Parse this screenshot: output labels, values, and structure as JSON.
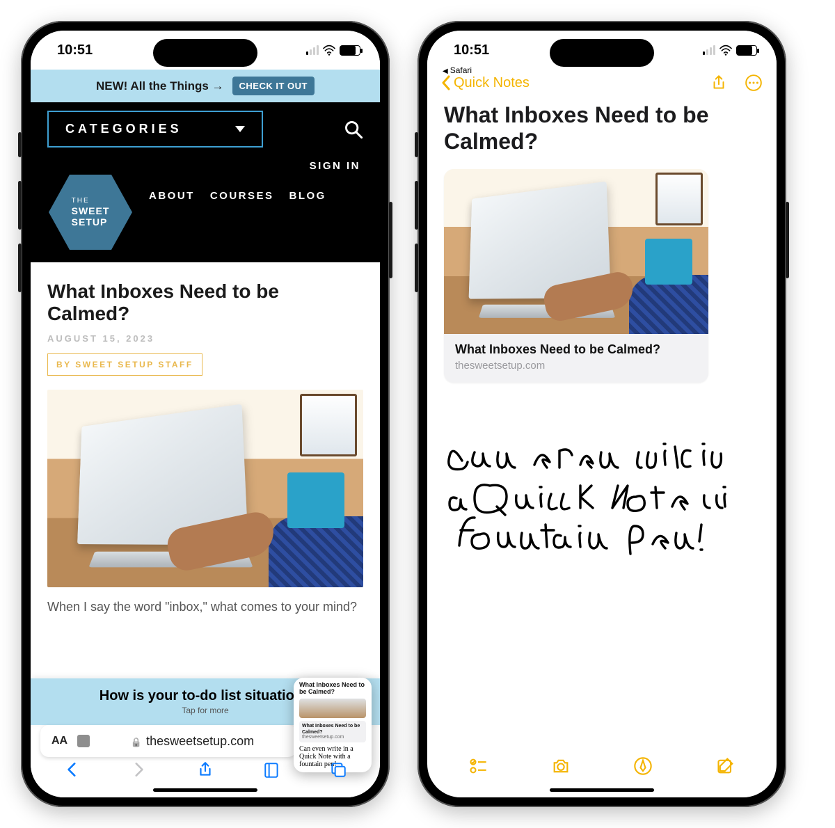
{
  "status": {
    "time": "10:51"
  },
  "breadcrumb": {
    "app": "Safari"
  },
  "left": {
    "banner": {
      "text": "NEW! All the Things →",
      "cta": "CHECK IT OUT"
    },
    "nav": {
      "categories": "CATEGORIES",
      "signin": "SIGN IN"
    },
    "logo": {
      "line1": "THE",
      "line2": "SWEET",
      "line3": "SETUP"
    },
    "subnav": [
      "ABOUT",
      "COURSES",
      "BLOG"
    ],
    "article": {
      "title": "What Inboxes Need to be Calmed?",
      "date": "AUGUST 15, 2023",
      "byline": "BY SWEET SETUP STAFF",
      "body_preview": "When I say the word \"inbox,\" what comes to your mind?"
    },
    "promo": {
      "title": "How is your to-do list situation?",
      "sub": "Tap for more"
    },
    "address": {
      "domain": "thesweetsetup.com",
      "aa": "AA"
    },
    "pip": {
      "title": "What Inboxes Need to be Calmed?",
      "card_title": "What Inboxes Need to be Calmed?",
      "card_domain": "thesweetsetup.com",
      "scribble": "Can even write in a Quick Note with a fountain pen!"
    }
  },
  "right": {
    "back_label": "Quick Notes",
    "note_title": "What Inboxes Need to be Calmed?",
    "card": {
      "title": "What Inboxes Need to be Calmed?",
      "domain": "thesweetsetup.com"
    },
    "handwriting": "Can even write in a Quick Note with a fountain pen!"
  }
}
